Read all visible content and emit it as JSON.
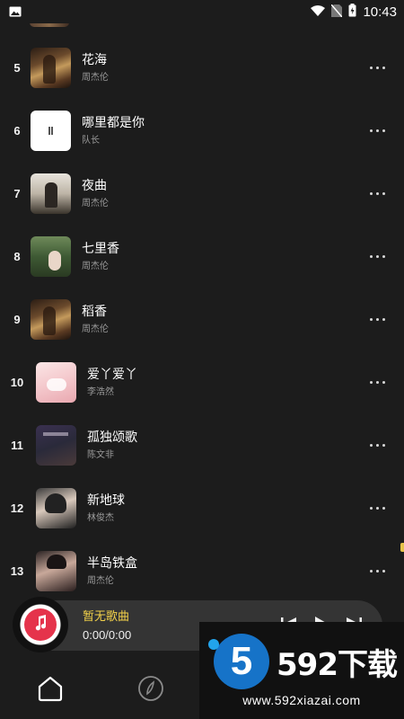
{
  "status_bar": {
    "time": "10:43",
    "icons": [
      "image-icon",
      "wifi-icon",
      "no-sim-icon",
      "battery-charging-icon"
    ]
  },
  "songs": [
    {
      "rank": "5",
      "title": "花海",
      "artist": "周杰伦",
      "thumb": "caoshan"
    },
    {
      "rank": "6",
      "title": "哪里都是你",
      "artist": "队长",
      "thumb": "white"
    },
    {
      "rank": "7",
      "title": "夜曲",
      "artist": "周杰伦",
      "thumb": "yequ"
    },
    {
      "rank": "8",
      "title": "七里香",
      "artist": "周杰伦",
      "thumb": "qili"
    },
    {
      "rank": "9",
      "title": "稻香",
      "artist": "周杰伦",
      "thumb": "caoshan"
    },
    {
      "rank": "10",
      "title": "爱丫爱丫",
      "artist": "李浩然",
      "thumb": "aiya"
    },
    {
      "rank": "11",
      "title": "孤独颂歌",
      "artist": "陈文非",
      "thumb": "gudu"
    },
    {
      "rank": "12",
      "title": "新地球",
      "artist": "林俊杰",
      "thumb": "xindiqiu"
    },
    {
      "rank": "13",
      "title": "半岛铁盒",
      "artist": "周杰伦",
      "thumb": "bandao"
    }
  ],
  "player": {
    "title": "暂无歌曲",
    "time": "0:00/0:00",
    "title_color": "#f3d24a",
    "disc_color": "#e5334b"
  },
  "nav": {
    "items": [
      "home-icon",
      "discover-icon"
    ]
  },
  "watermark": {
    "logo_text": "5",
    "brand": "592下载",
    "url": "www.592xiazai.com"
  }
}
